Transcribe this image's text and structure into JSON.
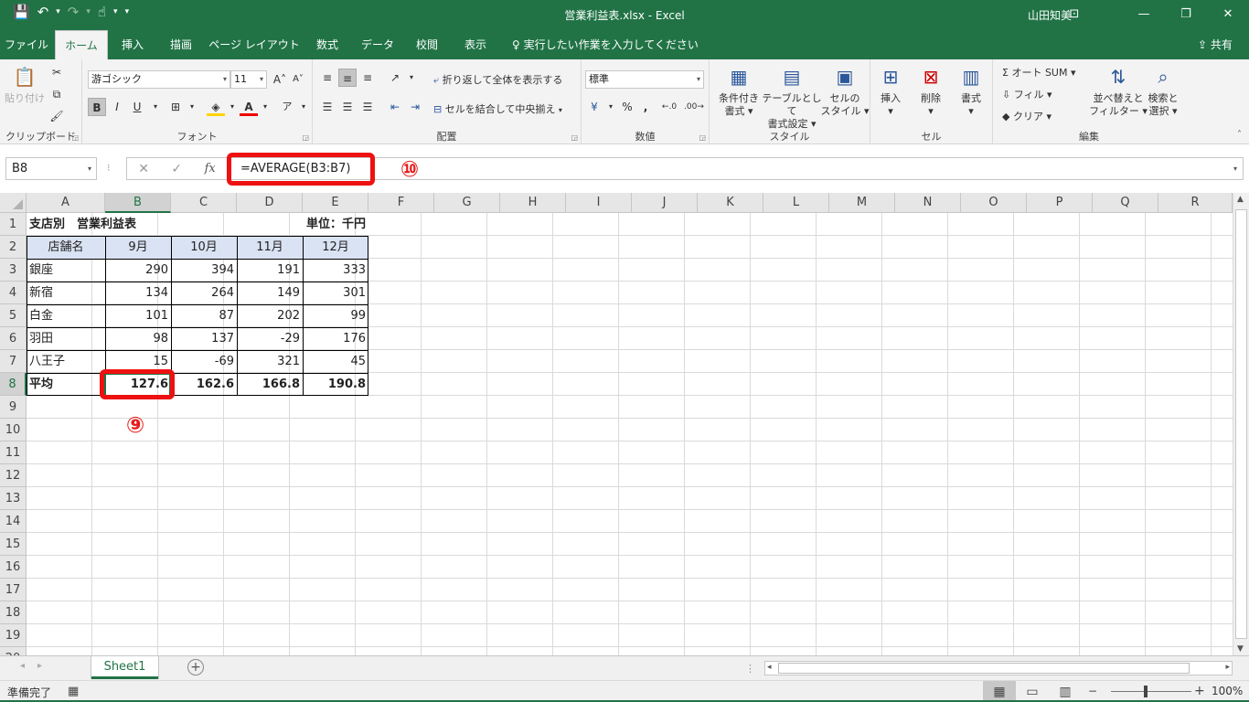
{
  "window": {
    "title": "営業利益表.xlsx  -  Excel",
    "user": "山田知美"
  },
  "qat": {
    "save_icon": "💾",
    "undo_icon": "↶",
    "redo_icon": "↷",
    "touch_icon": "☝",
    "customize_icon": "▾"
  },
  "window_controls": {
    "ribbon_options": "⊡",
    "minimize": "—",
    "restore": "❐",
    "close": "✕"
  },
  "tabs": [
    "ファイル",
    "ホーム",
    "挿入",
    "描画",
    "ページ レイアウト",
    "数式",
    "データ",
    "校閲",
    "表示"
  ],
  "tell_me": "♀ 実行したい作業を入力してください",
  "share": "⇪ 共有",
  "ribbon": {
    "clipboard": {
      "paste": "貼り付け",
      "label": "クリップボード"
    },
    "font": {
      "name": "游ゴシック",
      "size": "11",
      "grow": "A˄",
      "shrink": "A˅",
      "bold": "B",
      "italic": "I",
      "underline": "U",
      "label": "フォント"
    },
    "alignment": {
      "wrap": "折り返して全体を表示する",
      "merge": "セルを結合して中央揃え",
      "label": "配置"
    },
    "number": {
      "format": "標準",
      "percent": "%",
      "comma": ",",
      "inc": "←.0",
      "dec": ".00→",
      "label": "数値"
    },
    "styles": {
      "conditional": "条件付き\n書式 ▾",
      "table": "テーブルとして\n書式設定 ▾",
      "cell": "セルの\nスタイル ▾",
      "label": "スタイル"
    },
    "cells": {
      "insert": "挿入\n▾",
      "delete": "削除\n▾",
      "format": "書式\n▾",
      "label": "セル"
    },
    "editing": {
      "autosum": "Σ オート SUM ▾",
      "fill": "⇩ フィル ▾",
      "clear": "◆ クリア ▾",
      "sort": "並べ替えと\nフィルター ▾",
      "find": "検索と\n選択 ▾",
      "label": "編集"
    }
  },
  "formula_bar": {
    "name_box": "B8",
    "formula": "=AVERAGE(B3:B7)",
    "cancel": "✕",
    "enter": "✓",
    "fx": "fx"
  },
  "callouts": {
    "formula": "⑩",
    "cell": "⑨"
  },
  "columns": [
    "A",
    "B",
    "C",
    "D",
    "E",
    "F",
    "G",
    "H",
    "I",
    "J",
    "K",
    "L",
    "M",
    "N",
    "O",
    "P",
    "Q",
    "R"
  ],
  "rows": [
    "1",
    "2",
    "3",
    "4",
    "5",
    "6",
    "7",
    "8",
    "9",
    "10",
    "11",
    "12",
    "13",
    "14",
    "15",
    "16",
    "17",
    "18",
    "19",
    "20"
  ],
  "sheet": {
    "title": "支店別　営業利益表",
    "unit": "単位：千円",
    "headers": [
      "店舗名",
      "9月",
      "10月",
      "11月",
      "12月"
    ],
    "data": [
      [
        "銀座",
        "290",
        "394",
        "191",
        "333"
      ],
      [
        "新宿",
        "134",
        "264",
        "149",
        "301"
      ],
      [
        "白金",
        "101",
        "87",
        "202",
        "99"
      ],
      [
        "羽田",
        "98",
        "137",
        "-29",
        "176"
      ],
      [
        "八王子",
        "15",
        "-69",
        "321",
        "45"
      ]
    ],
    "average": [
      "平均",
      "127.6",
      "162.6",
      "166.8",
      "190.8"
    ]
  },
  "sheet_tabs": [
    "Sheet1"
  ],
  "status": {
    "text": "準備完了",
    "zoom": "100%"
  }
}
